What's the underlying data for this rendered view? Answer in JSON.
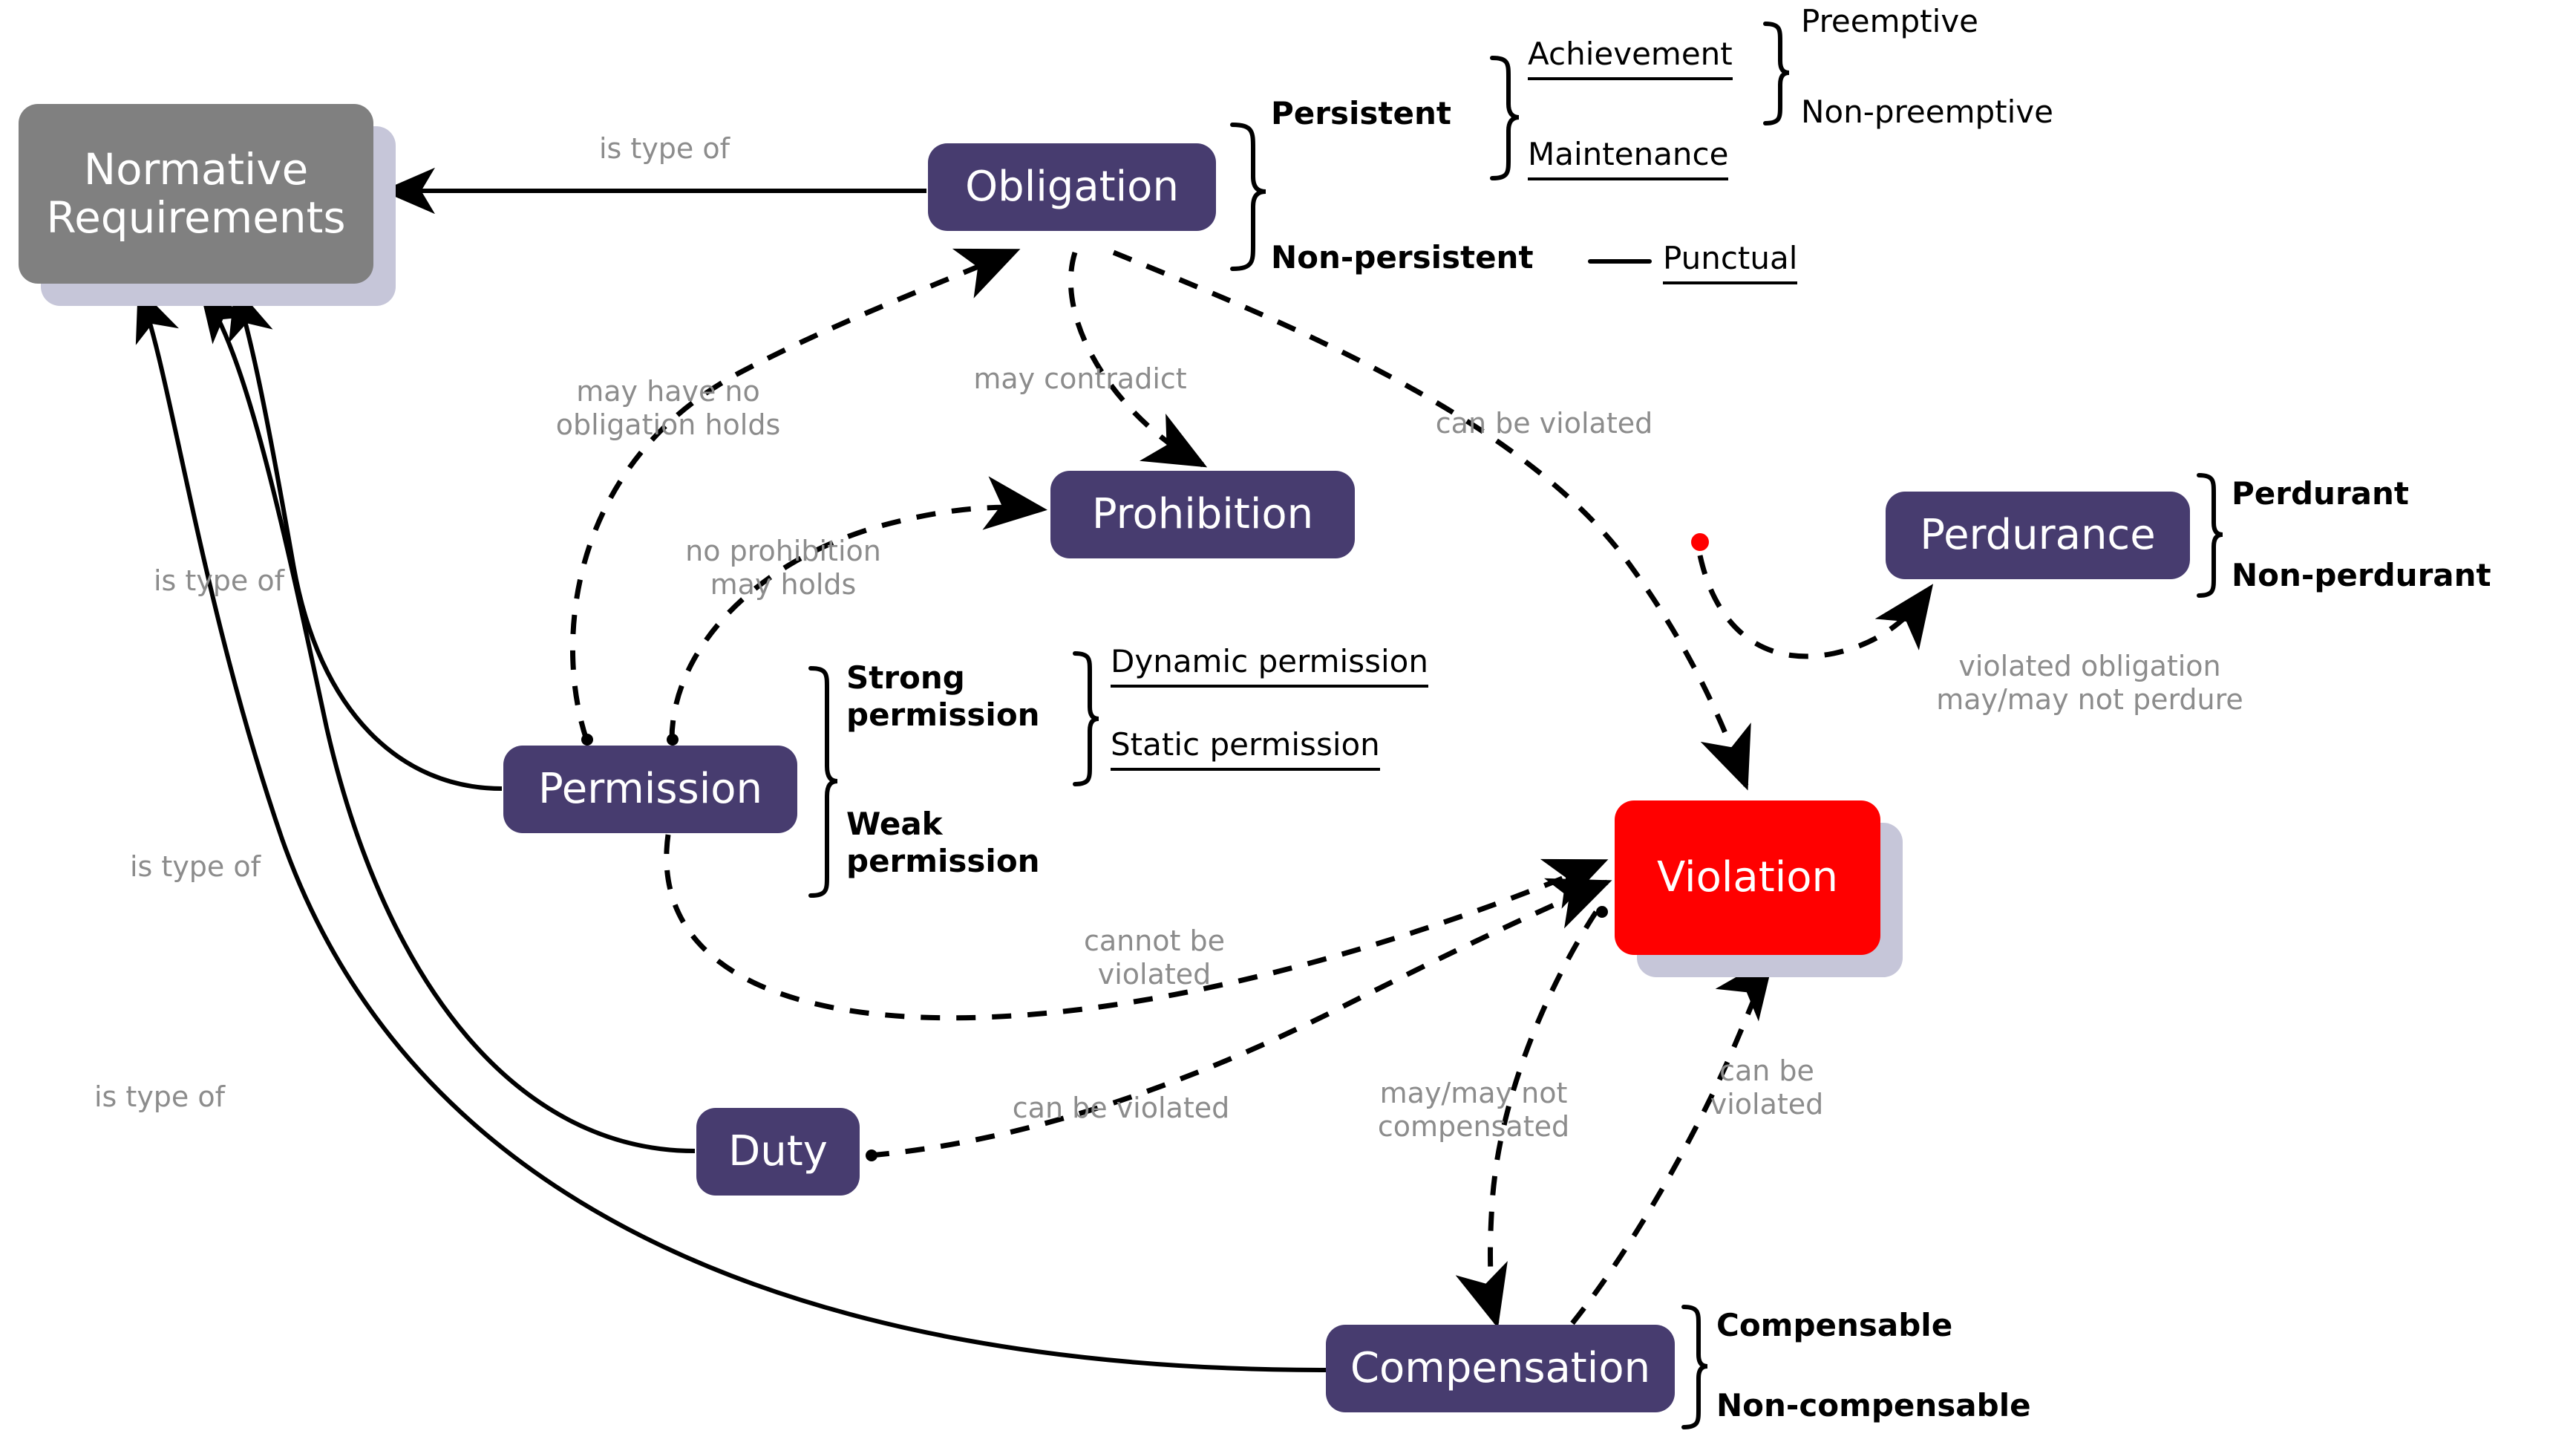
{
  "diagram": {
    "title": "Normative Requirements taxonomy",
    "colors": {
      "purple_node": "#473C6F",
      "gray_node": "#808080",
      "violation_node": "#FF0000",
      "shadow": "#C6C6D9",
      "edge_label": "#8C8C8C",
      "edge_line": "#000000",
      "red_marker": "#FF0000"
    }
  },
  "nodes": {
    "normative_requirements": "Normative\nRequirements",
    "obligation": "Obligation",
    "prohibition": "Prohibition",
    "permission": "Permission",
    "duty": "Duty",
    "violation": "Violation",
    "compensation": "Compensation",
    "perdurance": "Perdurance"
  },
  "taxonomy": {
    "obligation": {
      "persistent": "Persistent",
      "non_persistent": "Non-persistent",
      "achievement": "Achievement",
      "maintenance": "Maintenance",
      "punctual": "Punctual",
      "preemptive": "Preemptive",
      "non_preemptive": "Non-preemptive"
    },
    "permission": {
      "strong": "Strong\npermission",
      "weak": "Weak\npermission",
      "dynamic": "Dynamic permission",
      "static": "Static permission"
    },
    "perdurance": {
      "perdurant": "Perdurant",
      "non_perdurant": "Non-perdurant"
    },
    "compensation": {
      "compensable": "Compensable",
      "non_compensable": "Non-compensable"
    }
  },
  "edge_labels": {
    "obligation_is_type_of": "is type of",
    "permission_is_type_of": "is type of",
    "duty_is_type_of": "is type of",
    "compensation_is_type_of": "is type of",
    "may_have_no_obligation_holds": "may have no\nobligation holds",
    "may_contradict": "may contradict",
    "no_prohibition_may_holds": "no prohibition\nmay holds",
    "obligation_can_be_violated": "can be violated",
    "violated_obligation_may_perdure": "violated obligation\nmay/may not perdure",
    "permission_cannot_be_violated": "cannot be\nviolated",
    "duty_can_be_violated": "can be violated",
    "may_may_not_compensated": "may/may not\ncompensated",
    "compensation_can_be_violated": "can be\nviolated"
  }
}
